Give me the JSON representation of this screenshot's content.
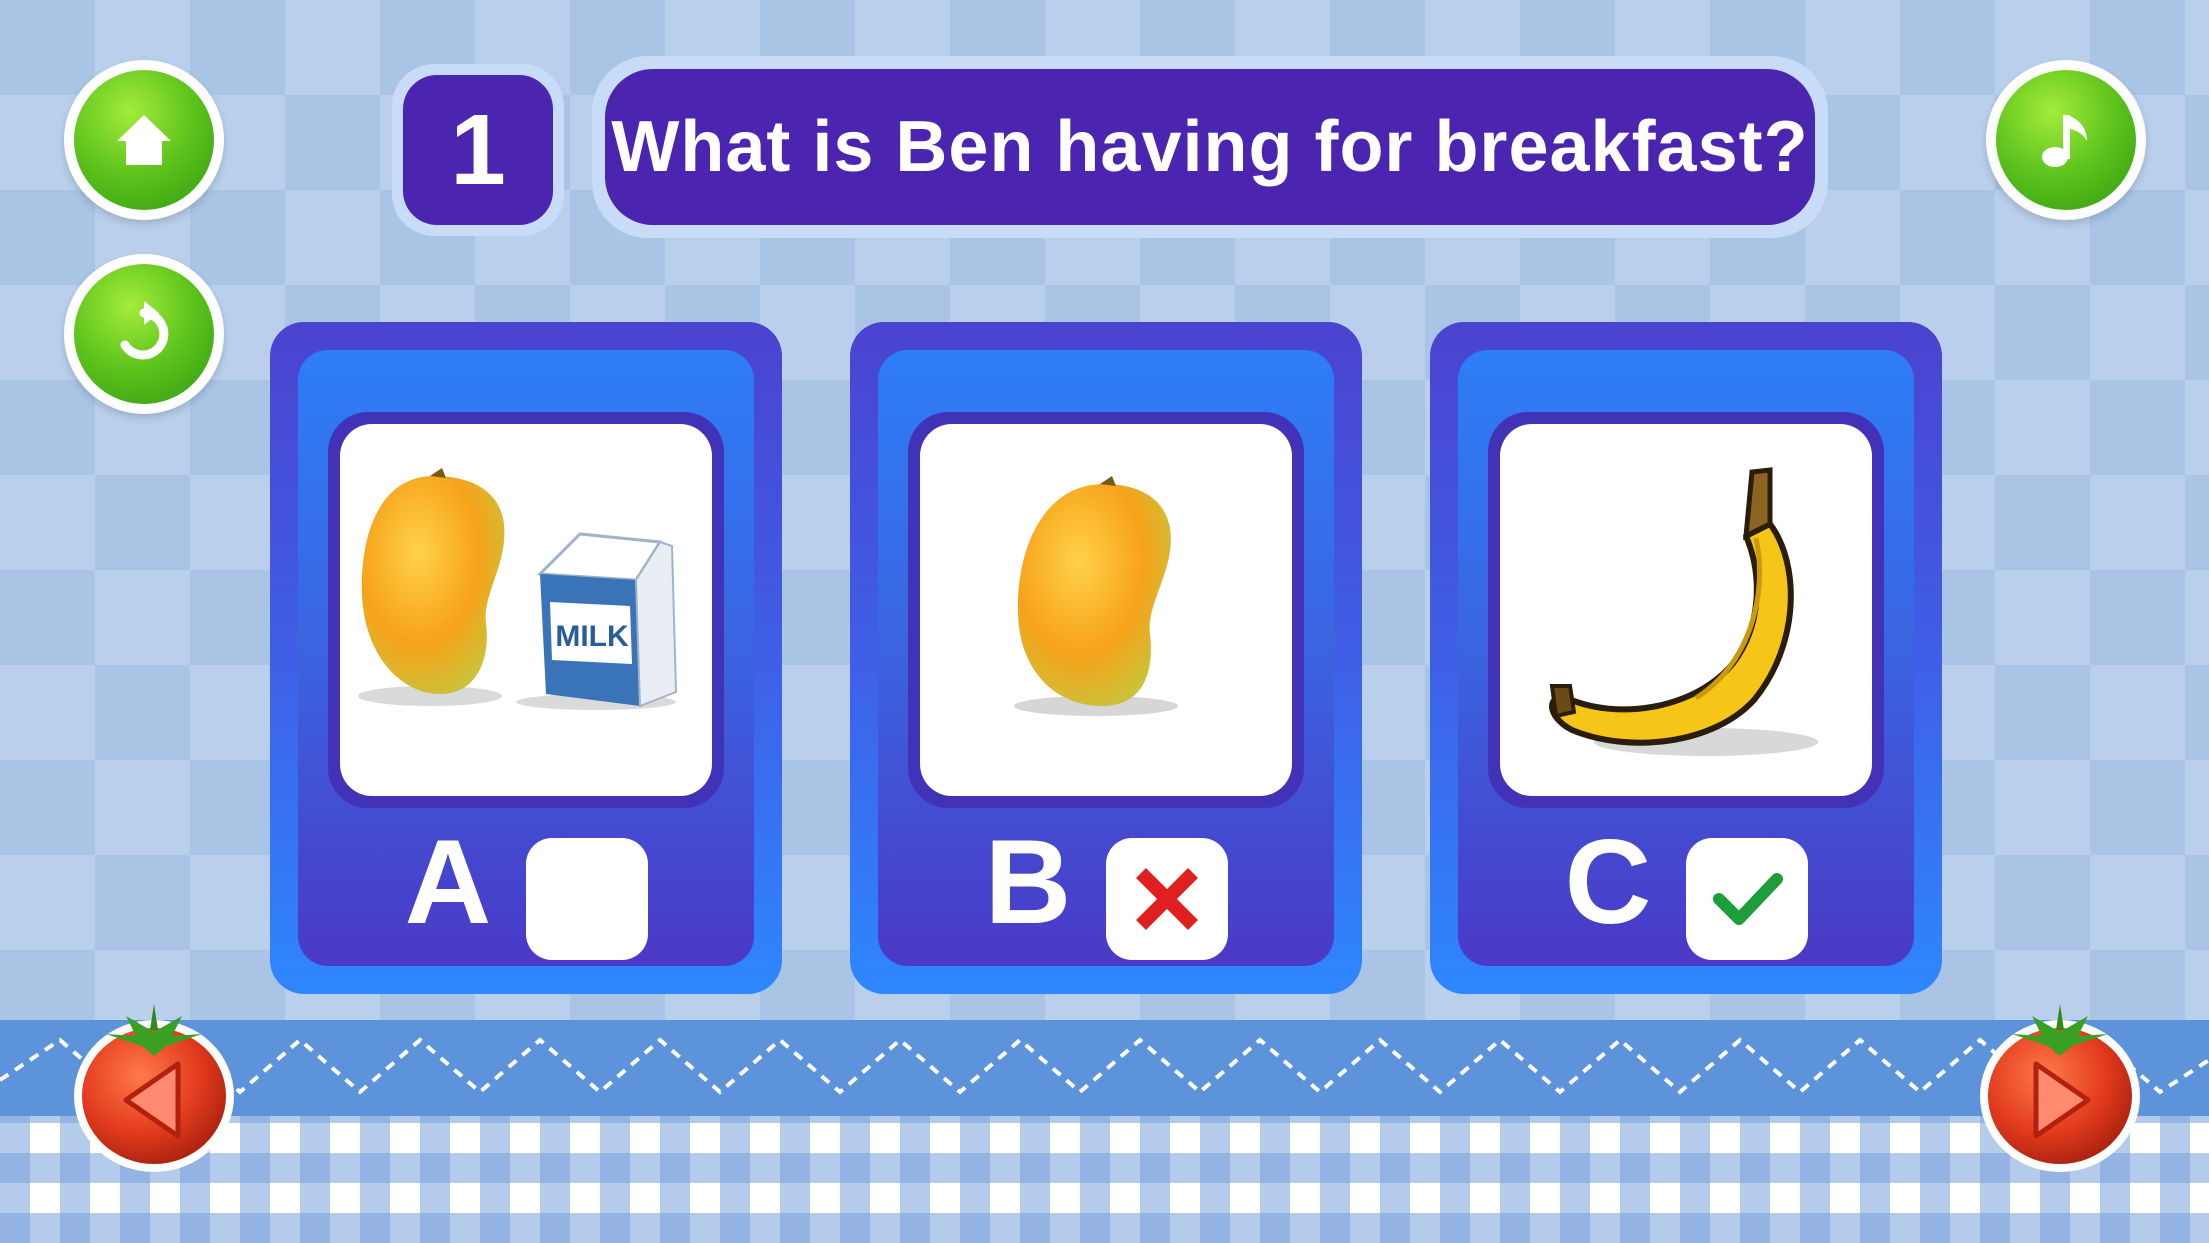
{
  "question": {
    "number": "1",
    "text": "What is Ben having for breakfast?"
  },
  "controls": {
    "home_icon": "home-icon",
    "replay_icon": "replay-icon",
    "music_icon": "music-note-icon",
    "prev_icon": "previous-arrow-icon",
    "next_icon": "next-arrow-icon"
  },
  "answers": [
    {
      "letter": "A",
      "picture": "mango-and-milk-carton",
      "picture_text": "MILK",
      "state": "empty"
    },
    {
      "letter": "B",
      "picture": "mango",
      "state": "wrong"
    },
    {
      "letter": "C",
      "picture": "banana",
      "state": "correct"
    }
  ],
  "colors": {
    "question_bg": "#4b24b0",
    "card_gradient_top": "#4a43cf",
    "card_gradient_bottom": "#2e87ff",
    "wrong_mark": "#e02020",
    "correct_mark": "#1e9e3a",
    "green_button": "#5cc21c",
    "tomato": "#e23b1e"
  }
}
